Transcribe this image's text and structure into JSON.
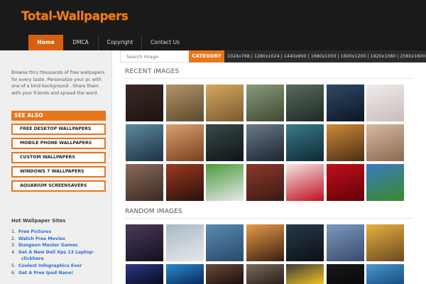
{
  "site": {
    "logo": "Total-Wallpapers"
  },
  "nav": [
    {
      "label": "Home",
      "active": true
    },
    {
      "label": "DMCA",
      "active": false
    },
    {
      "label": "Copyright",
      "active": false
    },
    {
      "label": "Contact Us",
      "active": false
    }
  ],
  "sidebar": {
    "intro": "Browse thru thousands of free wallpapers for every taste. Personalize your pc with one of a kind background . Share them with your friends and spread the word.",
    "see_also_title": "SEE ALSO",
    "see_also_items": [
      "FREE DESKTOP WALLPAPERS",
      "MOBILE PHONE WALLPAPERS",
      "CUSTOM WALLPAPERS",
      "WINDOWS 7 WALLPAPERS",
      "AQUARIUM SCREENSAVERS"
    ],
    "hot_title": "Hot Wallpaper Sites",
    "hot_links": [
      "Free Pictures",
      "Watch Free Movies",
      "Dungeon Master Games",
      "Get A New Dell Xps 13 Laptop-",
      "Coolest Infographics Ever",
      "Get A Free Ipod Nano!"
    ],
    "hot_link_continuation": "clickhere"
  },
  "search": {
    "placeholder": "Search Image",
    "category_label": "CATEGORY",
    "resolutions": "1024x768 | 1280x1024 | 1440x900 | 1680x1050 | 1600x1200 | 1920x1080 | 2560x1600"
  },
  "sections": {
    "recent_title": "RECENT IMAGES",
    "random_title": "RANDOM IMAGES"
  },
  "recent_images": [
    {
      "subject": "dark-forest-dusk",
      "colors": [
        "#3c2a26",
        "#1a1412"
      ]
    },
    {
      "subject": "fantasy-city",
      "colors": [
        "#b5946a",
        "#5a4a2c"
      ]
    },
    {
      "subject": "warrior-woman",
      "colors": [
        "#d6a860",
        "#7a5a2e"
      ]
    },
    {
      "subject": "castle-landscape",
      "colors": [
        "#8a9a7a",
        "#3e4a32"
      ]
    },
    {
      "subject": "winged-creature",
      "colors": [
        "#5a6a5e",
        "#1e2a26"
      ]
    },
    {
      "subject": "night-lake",
      "colors": [
        "#2e4a66",
        "#0c1622"
      ]
    },
    {
      "subject": "pale-figure",
      "colors": [
        "#f0eceb",
        "#c8bcbc"
      ]
    },
    {
      "subject": "blue-dragon",
      "colors": [
        "#5c8aa0",
        "#1e3240"
      ]
    },
    {
      "subject": "warrior-portrait",
      "colors": [
        "#d8a070",
        "#7a4020"
      ]
    },
    {
      "subject": "dark-angel",
      "colors": [
        "#3a4a4a",
        "#0e1414"
      ]
    },
    {
      "subject": "woman-face",
      "colors": [
        "#6a7a8a",
        "#1c2430"
      ]
    },
    {
      "subject": "couple-embrace",
      "colors": [
        "#3a7a8a",
        "#0e2a34"
      ]
    },
    {
      "subject": "golden-goddess",
      "colors": [
        "#d08a3a",
        "#4a2e14"
      ]
    },
    {
      "subject": "fairy-figure",
      "colors": [
        "#d8b8a0",
        "#8a6a50"
      ]
    },
    {
      "subject": "vampire-lady",
      "colors": [
        "#8a6a5a",
        "#3a2a22"
      ]
    },
    {
      "subject": "red-hair-woman",
      "colors": [
        "#9a3a22",
        "#2a100a"
      ]
    },
    {
      "subject": "football-kick",
      "colors": [
        "#4a9a3a",
        "#e8e8e8"
      ]
    },
    {
      "subject": "football-player",
      "colors": [
        "#8a3a2a",
        "#3a1a14"
      ]
    },
    {
      "subject": "liverpool-crest-white",
      "colors": [
        "#f4e4e4",
        "#c01020"
      ]
    },
    {
      "subject": "liverpool-crest-red",
      "colors": [
        "#c0101a",
        "#600008"
      ]
    },
    {
      "subject": "football-stadium",
      "colors": [
        "#3a7ac0",
        "#3a8a2a"
      ]
    }
  ],
  "random_images": [
    {
      "subject": "dark-fantasy",
      "colors": [
        "#4a3a5a",
        "#141020"
      ]
    },
    {
      "subject": "white-sports-car",
      "colors": [
        "#a8b8c8",
        "#e8e8e8"
      ]
    },
    {
      "subject": "sea-arch",
      "colors": [
        "#5a8ab0",
        "#2a4a6a"
      ]
    },
    {
      "subject": "sunset-smoke",
      "colors": [
        "#e89a4a",
        "#3a2010"
      ]
    },
    {
      "subject": "dark-street",
      "colors": [
        "#2a3a4a",
        "#0a1014"
      ]
    },
    {
      "subject": "city-skyline",
      "colors": [
        "#7a9ac0",
        "#3a4a6a"
      ]
    },
    {
      "subject": "beach-sunset",
      "colors": [
        "#e8b040",
        "#6a4a20"
      ]
    },
    {
      "subject": "gamer-lights",
      "colors": [
        "#2a3a8a",
        "#0a0a1a"
      ]
    },
    {
      "subject": "blue-water",
      "colors": [
        "#2a8ad0",
        "#0a2a5a"
      ]
    },
    {
      "subject": "actor-portrait",
      "colors": [
        "#6a4a3a",
        "#1a1010"
      ]
    },
    {
      "subject": "man-in-suit",
      "colors": [
        "#7a6a5a",
        "#2a201a"
      ]
    },
    {
      "subject": "caution-sign",
      "colors": [
        "#3a3a3a",
        "#f0c020"
      ]
    },
    {
      "subject": "dark-room",
      "colors": [
        "#1a1a1a",
        "#080808"
      ]
    },
    {
      "subject": "ocean-horizon",
      "colors": [
        "#4a9ad0",
        "#1a4a80"
      ]
    }
  ]
}
